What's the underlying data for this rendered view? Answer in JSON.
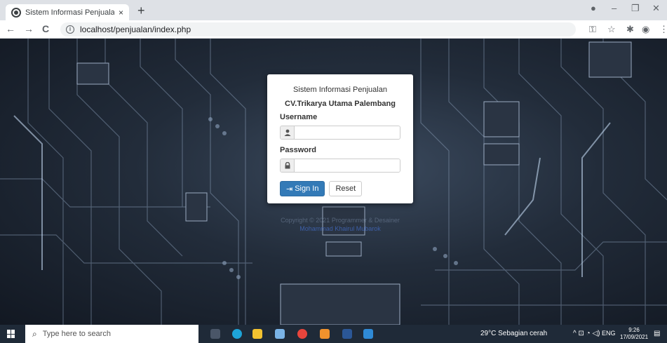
{
  "browser": {
    "tab_title": "Sistem Informasi Penjualan CV.Tr",
    "tab_close": "×",
    "new_tab": "+",
    "url": "localhost/penjualan/index.php",
    "back": "←",
    "forward": "→",
    "reload": "C"
  },
  "login": {
    "heading": "Sistem Informasi Penjualan",
    "company": "CV.Trikarya Utama Palembang",
    "username_label": "Username",
    "username_value": "",
    "password_label": "Password",
    "password_value": "",
    "signin_label": "Sign In",
    "reset_label": "Reset"
  },
  "footer": {
    "line1": "Copyright © 2021 Programmer & Desainer",
    "line2": "Mohammad Khairul Mubarok"
  },
  "taskbar": {
    "search_placeholder": "Type here to search",
    "weather": "29°C  Sebagian cerah",
    "language": "ENG",
    "time": "9:26",
    "date": "17/09/2021"
  },
  "colors": {
    "primary": "#337ab7",
    "taskbar": "#1f2a38"
  }
}
